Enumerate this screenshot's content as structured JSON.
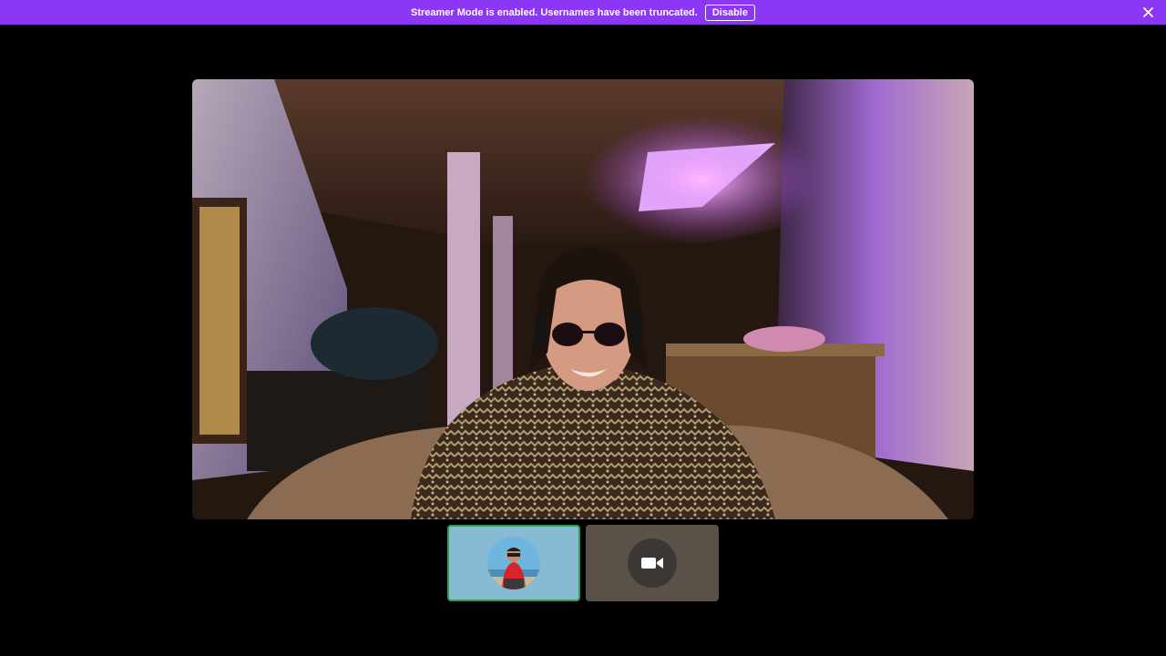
{
  "banner": {
    "message": "Streamer Mode is enabled. Usernames have been truncated.",
    "disable_label": "Disable",
    "close_icon": "close-icon",
    "background_color": "#8c37f5"
  },
  "main_video": {
    "content": "live-webcam-video"
  },
  "participants": [
    {
      "tile": "participant-avatar",
      "selected": true,
      "highlight_color": "#2ea043"
    },
    {
      "tile": "participant-video-off",
      "icon": "video-camera-icon",
      "selected": false
    }
  ]
}
